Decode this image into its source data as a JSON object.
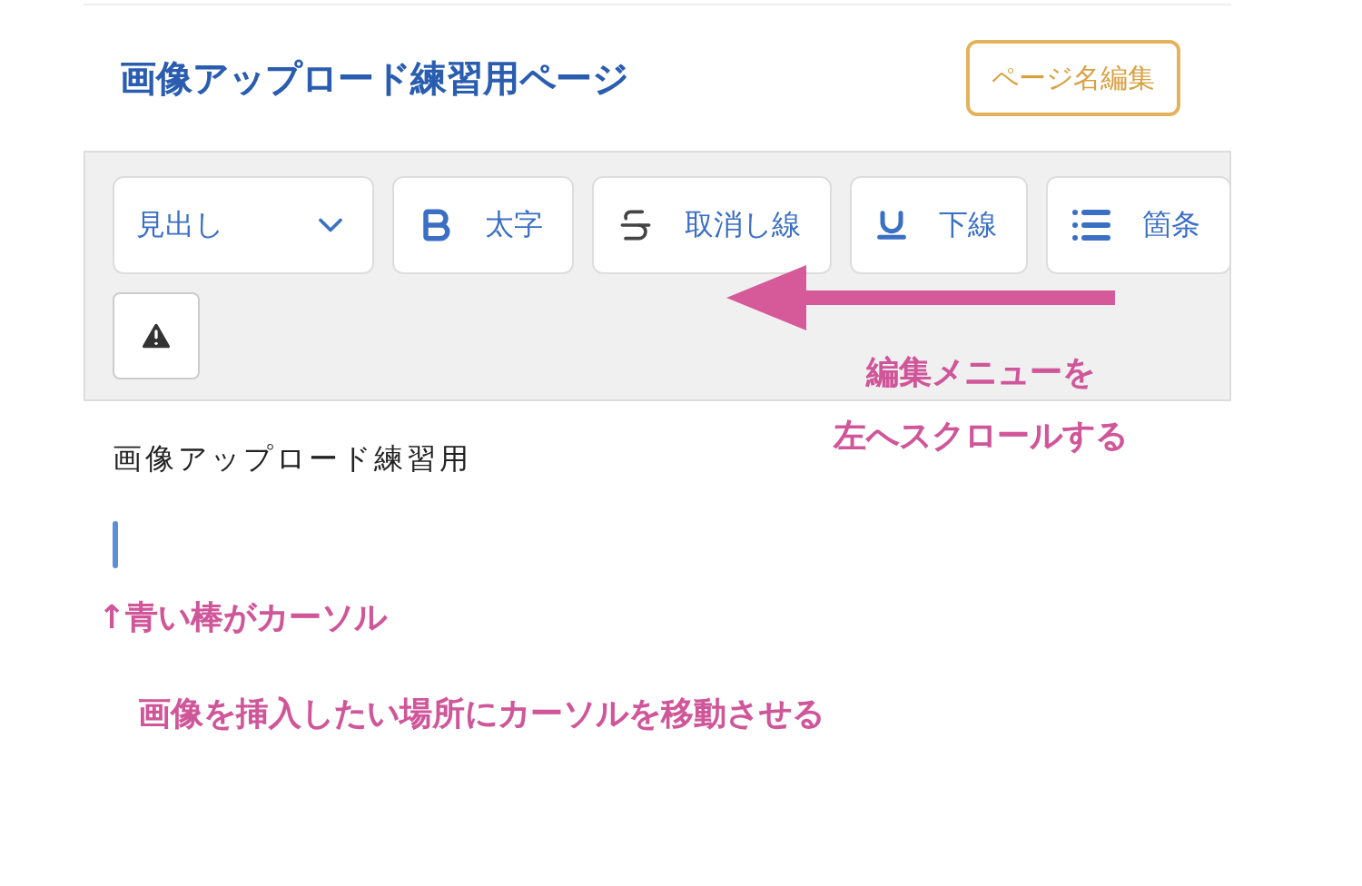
{
  "page_title": "画像アップロード練習用ページ",
  "edit_name_button": "ページ名編集",
  "toolbar": {
    "rows": [
      [
        {
          "kind": "dropdown",
          "label": "見出し"
        },
        {
          "kind": "bold",
          "label": "太字"
        },
        {
          "kind": "strike",
          "label": "取消し線"
        },
        {
          "kind": "underline",
          "label": "下線"
        },
        {
          "kind": "list",
          "label": "箇条"
        }
      ],
      [
        {
          "kind": "warning"
        }
      ]
    ]
  },
  "editor": {
    "lines": [
      "画像アップロード練習用"
    ],
    "cursor": true
  },
  "annotations": {
    "scroll_note": [
      "編集メニューを",
      "左へスクロールする"
    ],
    "cursor_note": "↑青い棒がカーソル",
    "instruction": "画像を挿入したい場所にカーソルを移動させる"
  }
}
